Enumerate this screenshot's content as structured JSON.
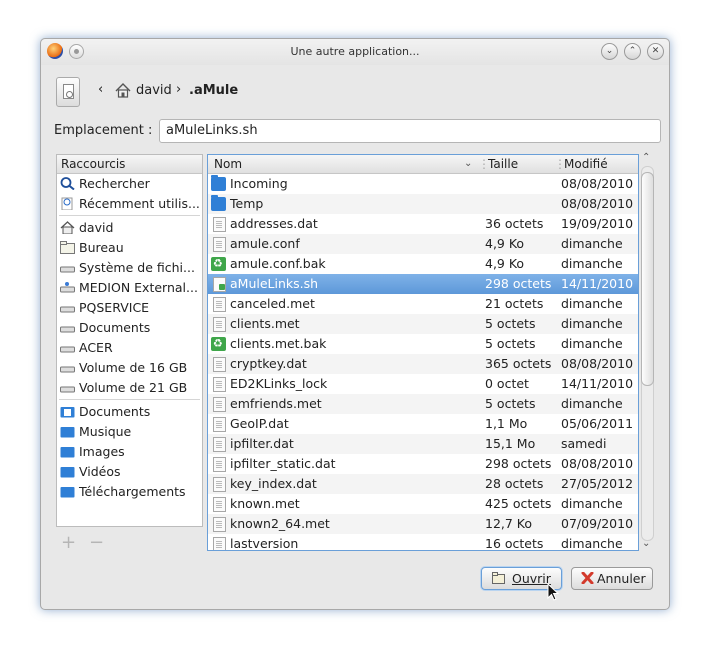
{
  "window": {
    "title": "Une autre application...",
    "controls": [
      "chevron-down-icon",
      "chevron-up-icon",
      "close-icon"
    ]
  },
  "breadcrumb": {
    "items": [
      {
        "label": "david",
        "icon": "home-icon"
      },
      {
        "label": ".aMule"
      }
    ]
  },
  "location": {
    "label": "Emplacement :",
    "value": "aMuleLinks.sh"
  },
  "places": {
    "header": "Raccourcis",
    "items": [
      {
        "label": "Rechercher",
        "icon": "search-icon"
      },
      {
        "label": "Récemment utilis...",
        "icon": "clock-icon"
      },
      {
        "label": "david",
        "icon": "home-icon"
      },
      {
        "label": "Bureau",
        "icon": "folder-icon"
      },
      {
        "label": "Système de fichi...",
        "icon": "drive-icon"
      },
      {
        "label": "MEDION External...",
        "icon": "usb-drive-icon"
      },
      {
        "label": "PQSERVICE",
        "icon": "drive-icon"
      },
      {
        "label": "Documents",
        "icon": "drive-icon"
      },
      {
        "label": "ACER",
        "icon": "drive-icon"
      },
      {
        "label": "Volume de 16 GB",
        "icon": "drive-icon"
      },
      {
        "label": "Volume de 21 GB",
        "icon": "drive-icon"
      },
      {
        "label": "Documents",
        "icon": "documents-folder-icon"
      },
      {
        "label": "Musique",
        "icon": "folder-icon"
      },
      {
        "label": "Images",
        "icon": "folder-icon"
      },
      {
        "label": "Vidéos",
        "icon": "folder-icon"
      },
      {
        "label": "Téléchargements",
        "icon": "folder-icon"
      }
    ],
    "add_label": "+",
    "remove_label": "−"
  },
  "files": {
    "columns": {
      "name": "Nom",
      "size": "Taille",
      "modified": "Modifié"
    },
    "rows": [
      {
        "name": "Incoming",
        "size": "",
        "date": "08/08/2010",
        "icon": "folder"
      },
      {
        "name": "Temp",
        "size": "",
        "date": "08/08/2010",
        "icon": "folder"
      },
      {
        "name": "addresses.dat",
        "size": "36 octets",
        "date": "19/09/2010",
        "icon": "doc"
      },
      {
        "name": "amule.conf",
        "size": "4,9 Ko",
        "date": "dimanche",
        "icon": "doc"
      },
      {
        "name": "amule.conf.bak",
        "size": "4,9 Ko",
        "date": "dimanche",
        "icon": "rec"
      },
      {
        "name": "aMuleLinks.sh",
        "size": "298 octets",
        "date": "14/11/2010",
        "icon": "sh",
        "selected": true
      },
      {
        "name": "canceled.met",
        "size": "21 octets",
        "date": "dimanche",
        "icon": "doc"
      },
      {
        "name": "clients.met",
        "size": "5 octets",
        "date": "dimanche",
        "icon": "doc"
      },
      {
        "name": "clients.met.bak",
        "size": "5 octets",
        "date": "dimanche",
        "icon": "rec"
      },
      {
        "name": "cryptkey.dat",
        "size": "365 octets",
        "date": "08/08/2010",
        "icon": "doc"
      },
      {
        "name": "ED2KLinks_lock",
        "size": "0 octet",
        "date": "14/11/2010",
        "icon": "doc"
      },
      {
        "name": "emfriends.met",
        "size": "5 octets",
        "date": "dimanche",
        "icon": "doc"
      },
      {
        "name": "GeoIP.dat",
        "size": "1,1 Mo",
        "date": "05/06/2011",
        "icon": "doc"
      },
      {
        "name": "ipfilter.dat",
        "size": "15,1 Mo",
        "date": "samedi",
        "icon": "doc"
      },
      {
        "name": "ipfilter_static.dat",
        "size": "298 octets",
        "date": "08/08/2010",
        "icon": "doc"
      },
      {
        "name": "key_index.dat",
        "size": "28 octets",
        "date": "27/05/2012",
        "icon": "doc"
      },
      {
        "name": "known.met",
        "size": "425 octets",
        "date": "dimanche",
        "icon": "doc"
      },
      {
        "name": "known2_64.met",
        "size": "12,7 Ko",
        "date": "07/09/2010",
        "icon": "doc"
      },
      {
        "name": "lastversion",
        "size": "16 octets",
        "date": "dimanche",
        "icon": "doc"
      }
    ]
  },
  "buttons": {
    "open": "Ouvrir",
    "cancel": "Annuler"
  },
  "colors": {
    "selection": "#5d98d9",
    "folder": "#2f7fd6",
    "cancel_icon": "#d33a2c"
  }
}
